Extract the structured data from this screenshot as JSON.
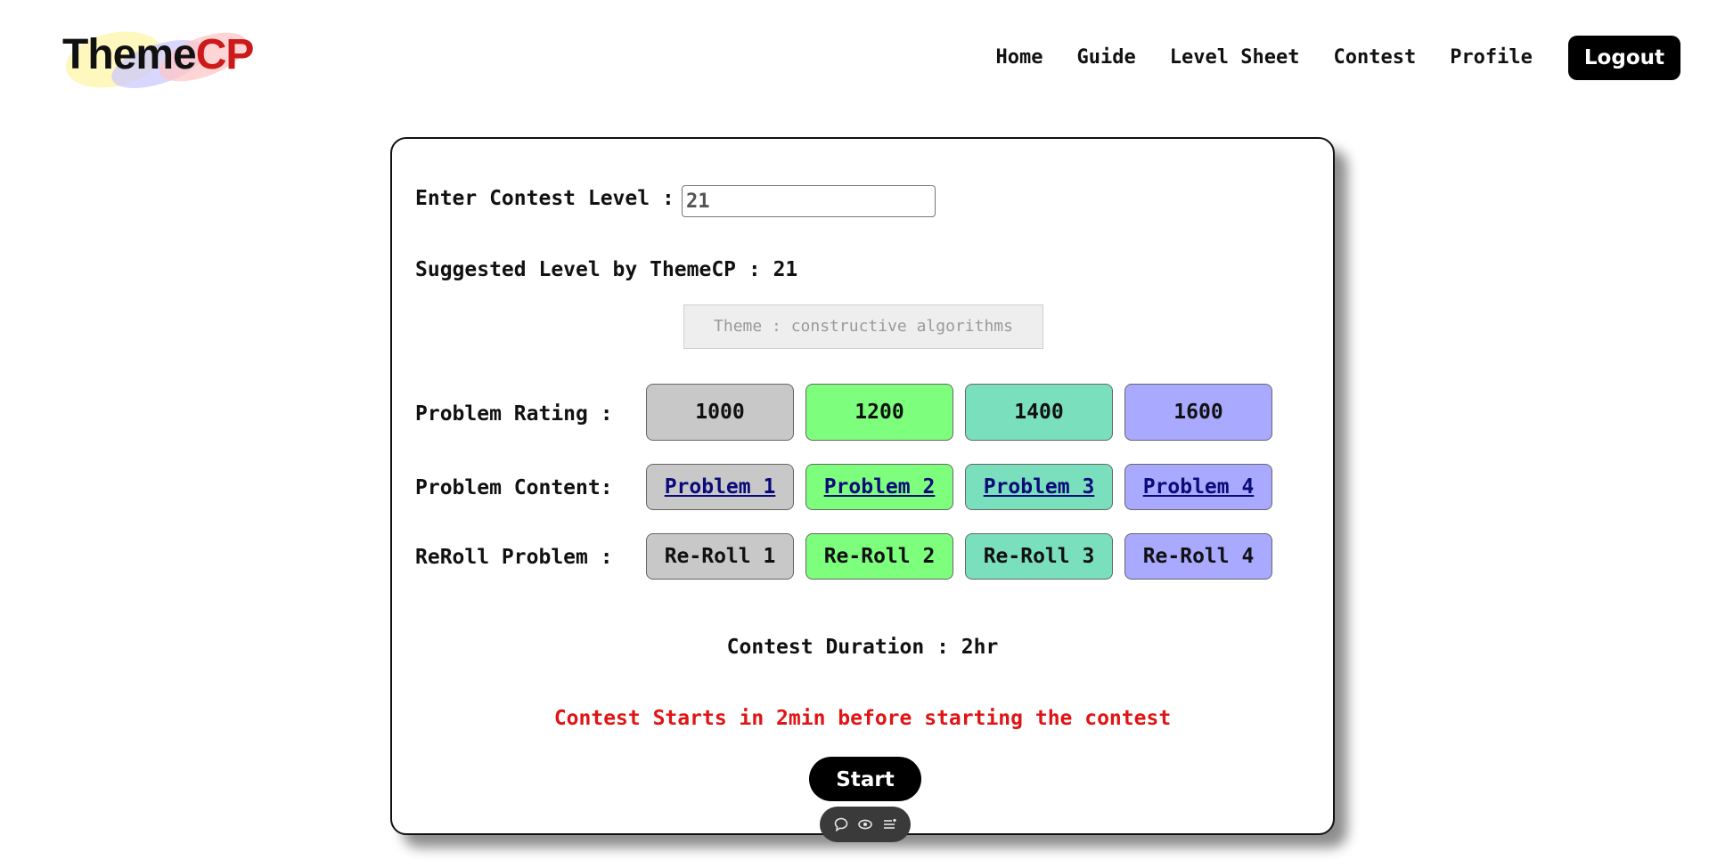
{
  "header": {
    "logo": {
      "part1": "Theme",
      "part2": "CP"
    },
    "nav": {
      "home": "Home",
      "guide": "Guide",
      "level_sheet": "Level Sheet",
      "contest": "Contest",
      "profile": "Profile",
      "logout": "Logout"
    }
  },
  "contest": {
    "level_label": "Enter Contest Level :",
    "level_value": "21",
    "suggested_label": "Suggested Level by ThemeCP : 21",
    "theme_text": "Theme : constructive algorithms",
    "rating_label": "Problem Rating :",
    "ratings": [
      "1000",
      "1200",
      "1400",
      "1600"
    ],
    "content_label": "Problem Content:",
    "problems": [
      "Problem 1",
      "Problem 2",
      "Problem 3",
      "Problem 4"
    ],
    "reroll_label": "ReRoll Problem :",
    "rerolls": [
      "Re-Roll 1",
      "Re-Roll 2",
      "Re-Roll 3",
      "Re-Roll 4"
    ],
    "duration": "Contest Duration : 2hr",
    "warning": "Contest Starts in 2min before starting the contest",
    "start_label": "Start"
  },
  "colors": {
    "level_1": "#c8c8c8",
    "level_2": "#7dff7d",
    "level_3": "#7adfbd",
    "level_4": "#a9a9ff",
    "warning": "#e01414",
    "logo_accent": "#cc1a1a"
  },
  "toolbar_icons": [
    "chat-bubble-icon",
    "eye-icon",
    "list-icon"
  ]
}
